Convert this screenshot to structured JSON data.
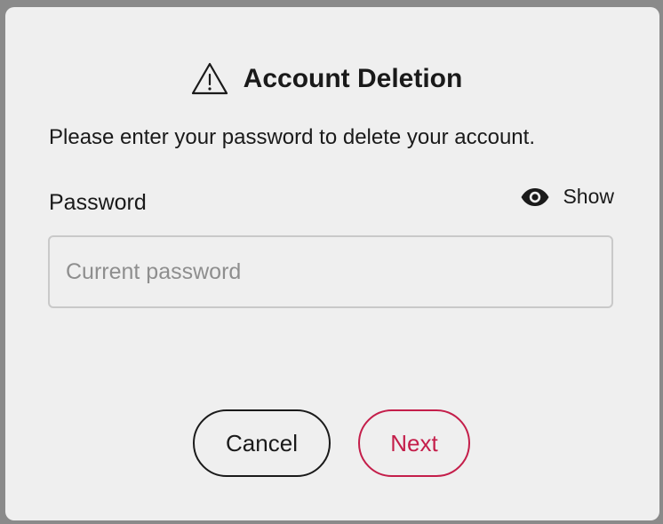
{
  "dialog": {
    "title": "Account Deletion",
    "title_icon": "warning-triangle-icon",
    "description": "Please enter your password to delete your account.",
    "password_label": "Password",
    "show_toggle": {
      "icon": "eye-icon",
      "label": "Show"
    },
    "password_input": {
      "value": "",
      "placeholder": "Current password"
    },
    "buttons": {
      "cancel_label": "Cancel",
      "next_label": "Next"
    }
  },
  "colors": {
    "background_overlay": "#8a8a8a",
    "dialog_background": "#efefef",
    "text": "#1a1a1a",
    "accent": "#c41e4a",
    "input_border": "#c9c9c9",
    "placeholder": "#8e8e8e"
  }
}
